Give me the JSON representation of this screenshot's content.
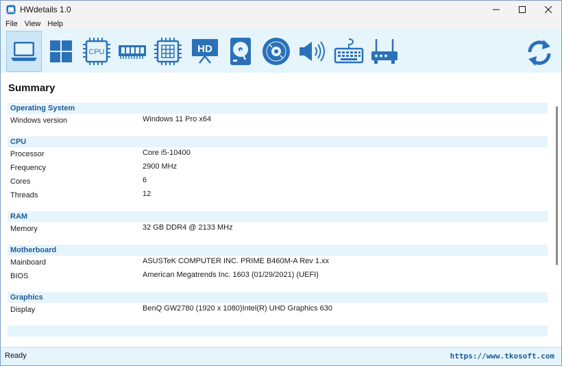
{
  "window": {
    "title": "HWdetails 1.0",
    "accent": "#1d5b9a",
    "toolbar_bg": "#e6f4fb"
  },
  "menu": {
    "items": [
      "File",
      "View",
      "Help"
    ]
  },
  "toolbar": {
    "buttons": [
      {
        "icon": "laptop-icon",
        "active": true
      },
      {
        "icon": "windows-icon"
      },
      {
        "icon": "cpu-icon",
        "label": "CPU"
      },
      {
        "icon": "ram-icon"
      },
      {
        "icon": "motherboard-icon"
      },
      {
        "icon": "monitor-icon",
        "label": "HD"
      },
      {
        "icon": "hard-disk-icon"
      },
      {
        "icon": "optical-disc-icon"
      },
      {
        "icon": "speaker-icon"
      },
      {
        "icon": "keyboard-icon"
      },
      {
        "icon": "router-icon"
      }
    ],
    "refresh_icon": "refresh-icon"
  },
  "summary": {
    "title": "Summary",
    "sections": [
      {
        "name": "Operating System",
        "rows": [
          {
            "label": "Windows version",
            "value": "Windows 11 Pro x64"
          }
        ]
      },
      {
        "name": "CPU",
        "rows": [
          {
            "label": "Processor",
            "value": "Core i5-10400"
          },
          {
            "label": "Frequency",
            "value": "2900 MHz"
          },
          {
            "label": "Cores",
            "value": "6"
          },
          {
            "label": "Threads",
            "value": "12"
          }
        ]
      },
      {
        "name": "RAM",
        "rows": [
          {
            "label": "Memory",
            "value": "32 GB DDR4 @ 2133 MHz"
          }
        ]
      },
      {
        "name": "Motherboard",
        "rows": [
          {
            "label": "Mainboard",
            "value": "ASUSTeK COMPUTER INC. PRIME B460M-A Rev 1.xx"
          },
          {
            "label": "BIOS",
            "value": "American Megatrends Inc. 1603 (01/29/2021) (UEFI)"
          }
        ]
      },
      {
        "name": "Graphics",
        "rows": [
          {
            "label": "Display",
            "value": "BenQ GW2780 (1920 x 1080)Intel(R) UHD Graphics 630"
          }
        ]
      }
    ]
  },
  "status": {
    "text": "Ready",
    "link": "https://www.tkosoft.com"
  }
}
